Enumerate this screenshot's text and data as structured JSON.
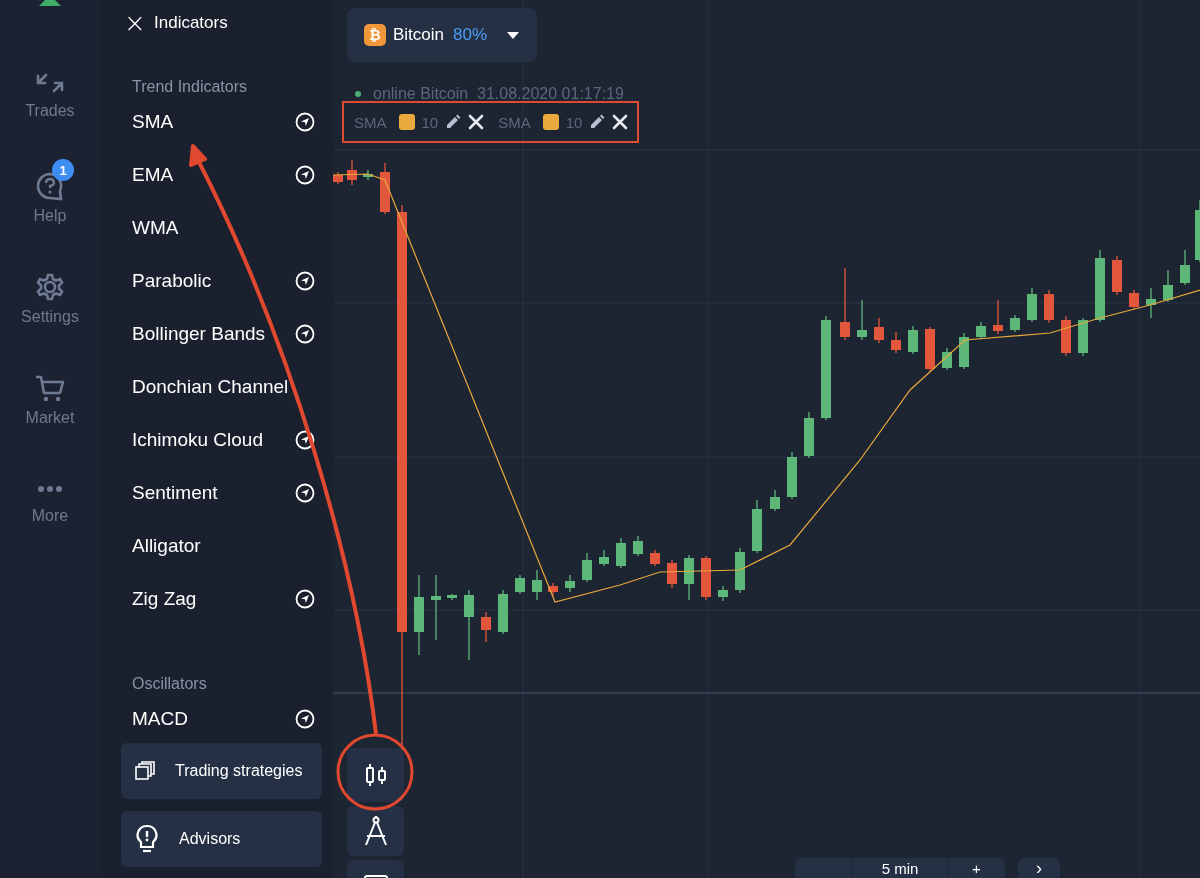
{
  "sidebar": {
    "items": [
      {
        "label": "Trades"
      },
      {
        "label": "Help",
        "badge": "1"
      },
      {
        "label": "Settings"
      },
      {
        "label": "Market"
      },
      {
        "label": "More"
      }
    ]
  },
  "panel": {
    "close": "×",
    "title": "Indicators",
    "sections": [
      {
        "heading": "Trend Indicators",
        "items": [
          {
            "label": "SMA",
            "info": true
          },
          {
            "label": "EMA",
            "info": true
          },
          {
            "label": "WMA",
            "info": false
          },
          {
            "label": "Parabolic",
            "info": true
          },
          {
            "label": "Bollinger Bands",
            "info": true
          },
          {
            "label": "Donchian Channel",
            "info": false
          },
          {
            "label": "Ichimoku Cloud",
            "info": true
          },
          {
            "label": "Sentiment",
            "info": true
          },
          {
            "label": "Alligator",
            "info": false
          },
          {
            "label": "Zig Zag",
            "info": true
          }
        ]
      },
      {
        "heading": "Oscillators",
        "items": [
          {
            "label": "MACD",
            "info": true
          }
        ]
      }
    ],
    "actions": [
      "Trading strategies",
      "Advisors"
    ]
  },
  "asset": {
    "glyph": "₿",
    "name": "Bitcoin",
    "payout": "80%"
  },
  "status": {
    "online": true,
    "text": "online Bitcoin  31.08.2020 01:17:19"
  },
  "active_indicators": [
    {
      "name": "SMA",
      "color": "#e9a93c",
      "period": "10"
    },
    {
      "name": "SMA",
      "color": "#e9a93c",
      "period": "10"
    }
  ],
  "timeframe": {
    "label": "5 min",
    "plus": "+",
    "next": "›"
  }
}
